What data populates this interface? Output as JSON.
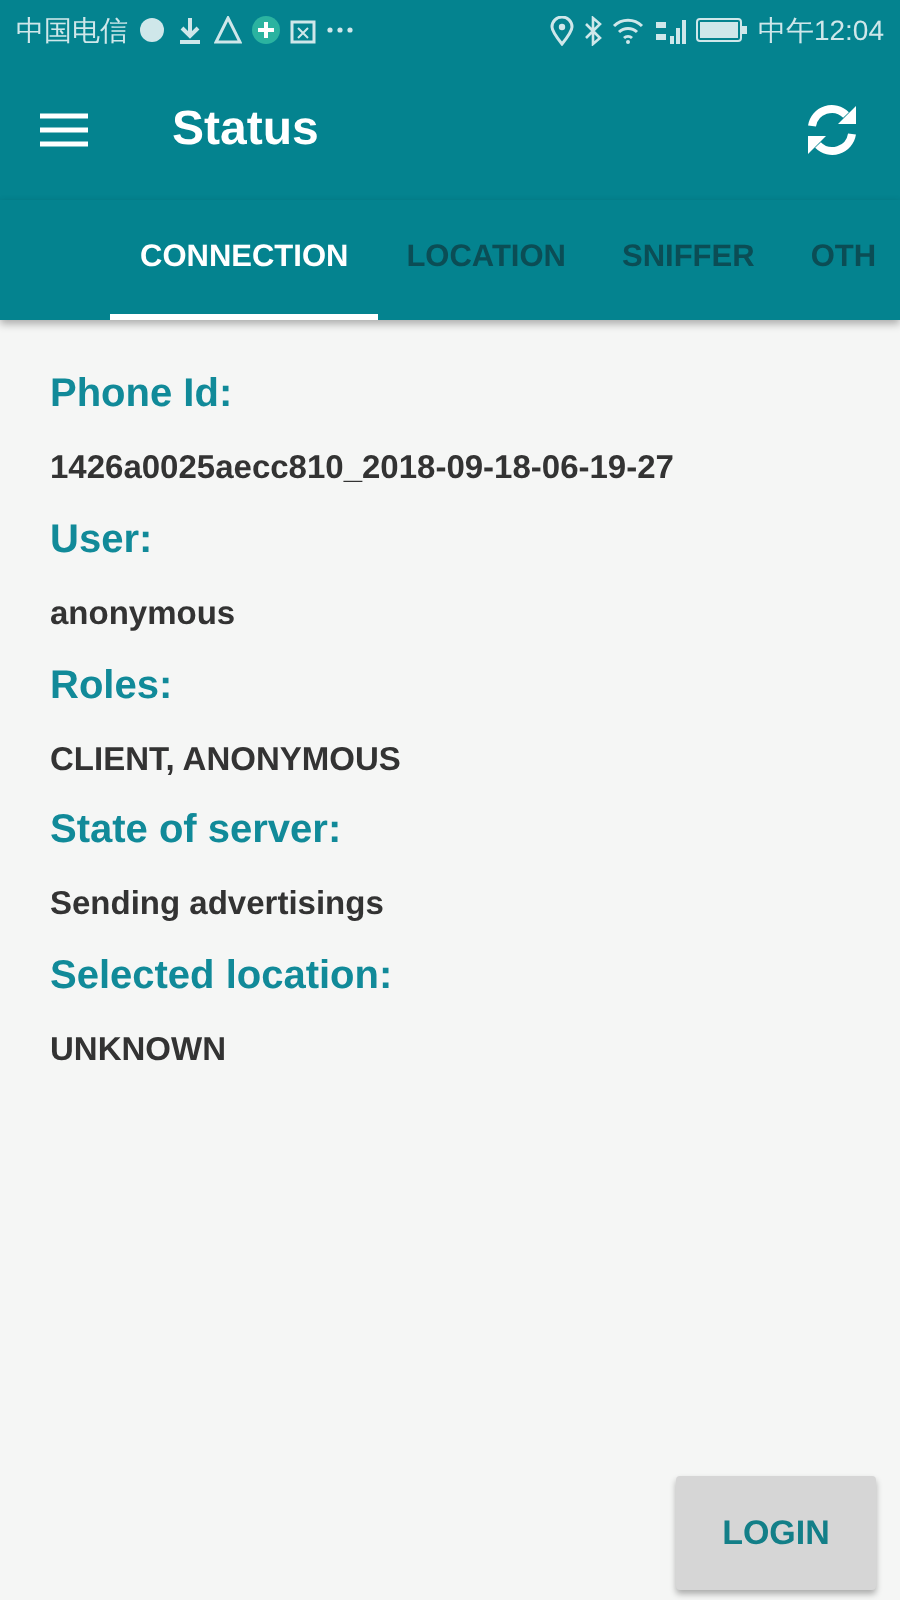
{
  "status_bar": {
    "carrier": "中国电信",
    "time": "中午12:04"
  },
  "toolbar": {
    "title": "Status"
  },
  "tabs": [
    {
      "label": "CONNECTION",
      "selected": true
    },
    {
      "label": "LOCATION",
      "selected": false
    },
    {
      "label": "SNIFFER",
      "selected": false
    },
    {
      "label": "OTH",
      "selected": false
    }
  ],
  "fields": [
    {
      "label": "Phone Id:",
      "value": "1426a0025aecc810_2018-09-18-06-19-27"
    },
    {
      "label": "User:",
      "value": "anonymous"
    },
    {
      "label": "Roles:",
      "value": "CLIENT, ANONYMOUS"
    },
    {
      "label": "State of server:",
      "value": "Sending advertisings"
    },
    {
      "label": "Selected location:",
      "value": "UNKNOWN"
    }
  ],
  "login_button": "LOGIN"
}
